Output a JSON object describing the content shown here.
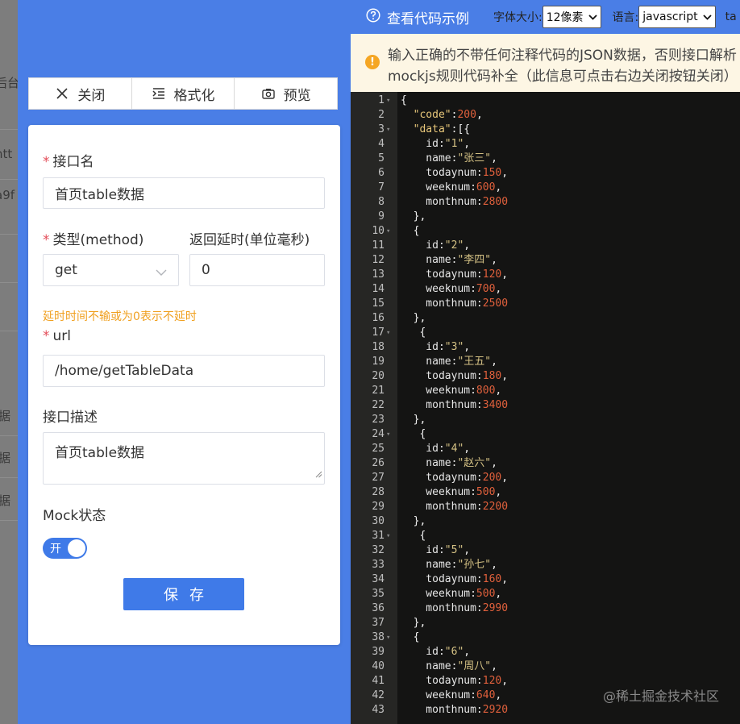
{
  "bg_page": {
    "fragments": [
      "后台",
      "htt",
      "a9f",
      "据",
      "据",
      "据"
    ]
  },
  "toolbar": {
    "close_label": "关闭",
    "format_label": "格式化",
    "preview_label": "预览"
  },
  "form": {
    "name_label": "接口名",
    "name_value": "首页table数据",
    "type_label": "类型(method)",
    "type_value": "get",
    "delay_label": "返回延时(单位毫秒)",
    "delay_value": "0",
    "delay_hint": "延时时间不输或为0表示不延时",
    "url_label": "url",
    "url_value": "/home/getTableData",
    "desc_label": "接口描述",
    "desc_value": "首页table数据",
    "mock_label": "Mock状态",
    "mock_toggle_text": "开",
    "mock_enabled": true,
    "save_label": "保存"
  },
  "editor_bar": {
    "code_example_label": "查看代码示例",
    "font_size_label": "字体大小:",
    "font_size_value": "12像素",
    "language_label": "语言:",
    "language_value": "javascript",
    "extra_label": "ta"
  },
  "warning": {
    "line1": "输入正确的不带任何注释代码的JSON数据，否则接口解析",
    "line2": "mockjs规则代码补全（此信息可点击右边关闭按钮关闭）"
  },
  "code_lines": [
    {
      "n": "1",
      "fold": true,
      "t": [
        [
          "{",
          "brace"
        ]
      ]
    },
    {
      "n": "2",
      "t": [
        [
          "  ",
          ""
        ],
        [
          "\"code\"",
          "qkey"
        ],
        [
          ":",
          "brace"
        ],
        [
          "200",
          "num"
        ],
        [
          ",",
          "brace"
        ]
      ]
    },
    {
      "n": "3",
      "fold": true,
      "t": [
        [
          "  ",
          ""
        ],
        [
          "\"data\"",
          "qkey"
        ],
        [
          ":[{",
          "brace"
        ]
      ]
    },
    {
      "n": "4",
      "t": [
        [
          "    id:",
          "key"
        ],
        [
          "\"1\"",
          "str"
        ],
        [
          ",",
          "brace"
        ]
      ]
    },
    {
      "n": "5",
      "t": [
        [
          "    name:",
          "key"
        ],
        [
          "\"张三\"",
          "str"
        ],
        [
          ",",
          "brace"
        ]
      ]
    },
    {
      "n": "6",
      "t": [
        [
          "    todaynum:",
          "key"
        ],
        [
          "150",
          "num"
        ],
        [
          ",",
          "brace"
        ]
      ]
    },
    {
      "n": "7",
      "t": [
        [
          "    weeknum:",
          "key"
        ],
        [
          "600",
          "num"
        ],
        [
          ",",
          "brace"
        ]
      ]
    },
    {
      "n": "8",
      "t": [
        [
          "    monthnum:",
          "key"
        ],
        [
          "2800",
          "num"
        ]
      ]
    },
    {
      "n": "9",
      "t": [
        [
          "  },",
          "brace"
        ]
      ]
    },
    {
      "n": "10",
      "fold": true,
      "t": [
        [
          "  {",
          "brace"
        ]
      ]
    },
    {
      "n": "11",
      "t": [
        [
          "    id:",
          "key"
        ],
        [
          "\"2\"",
          "str"
        ],
        [
          ",",
          "brace"
        ]
      ]
    },
    {
      "n": "12",
      "t": [
        [
          "    name:",
          "key"
        ],
        [
          "\"李四\"",
          "str"
        ],
        [
          ",",
          "brace"
        ]
      ]
    },
    {
      "n": "13",
      "t": [
        [
          "    todaynum:",
          "key"
        ],
        [
          "120",
          "num"
        ],
        [
          ",",
          "brace"
        ]
      ]
    },
    {
      "n": "14",
      "t": [
        [
          "    weeknum:",
          "key"
        ],
        [
          "700",
          "num"
        ],
        [
          ",",
          "brace"
        ]
      ]
    },
    {
      "n": "15",
      "t": [
        [
          "    monthnum:",
          "key"
        ],
        [
          "2500",
          "num"
        ]
      ]
    },
    {
      "n": "16",
      "t": [
        [
          "  },",
          "brace"
        ]
      ]
    },
    {
      "n": "17",
      "fold": true,
      "t": [
        [
          "   {",
          "brace"
        ]
      ]
    },
    {
      "n": "18",
      "t": [
        [
          "    id:",
          "key"
        ],
        [
          "\"3\"",
          "str"
        ],
        [
          ",",
          "brace"
        ]
      ]
    },
    {
      "n": "19",
      "t": [
        [
          "    name:",
          "key"
        ],
        [
          "\"王五\"",
          "str"
        ],
        [
          ",",
          "brace"
        ]
      ]
    },
    {
      "n": "20",
      "t": [
        [
          "    todaynum:",
          "key"
        ],
        [
          "180",
          "num"
        ],
        [
          ",",
          "brace"
        ]
      ]
    },
    {
      "n": "21",
      "t": [
        [
          "    weeknum:",
          "key"
        ],
        [
          "800",
          "num"
        ],
        [
          ",",
          "brace"
        ]
      ]
    },
    {
      "n": "22",
      "t": [
        [
          "    monthnum:",
          "key"
        ],
        [
          "3400",
          "num"
        ]
      ]
    },
    {
      "n": "23",
      "t": [
        [
          "  },",
          "brace"
        ]
      ]
    },
    {
      "n": "24",
      "fold": true,
      "t": [
        [
          "   {",
          "brace"
        ]
      ]
    },
    {
      "n": "25",
      "t": [
        [
          "    id:",
          "key"
        ],
        [
          "\"4\"",
          "str"
        ],
        [
          ",",
          "brace"
        ]
      ]
    },
    {
      "n": "26",
      "t": [
        [
          "    name:",
          "key"
        ],
        [
          "\"赵六\"",
          "str"
        ],
        [
          ",",
          "brace"
        ]
      ]
    },
    {
      "n": "27",
      "t": [
        [
          "    todaynum:",
          "key"
        ],
        [
          "200",
          "num"
        ],
        [
          ",",
          "brace"
        ]
      ]
    },
    {
      "n": "28",
      "t": [
        [
          "    weeknum:",
          "key"
        ],
        [
          "500",
          "num"
        ],
        [
          ",",
          "brace"
        ]
      ]
    },
    {
      "n": "29",
      "t": [
        [
          "    monthnum:",
          "key"
        ],
        [
          "2200",
          "num"
        ]
      ]
    },
    {
      "n": "30",
      "t": [
        [
          "  },",
          "brace"
        ]
      ]
    },
    {
      "n": "31",
      "fold": true,
      "t": [
        [
          "   {",
          "brace"
        ]
      ]
    },
    {
      "n": "32",
      "t": [
        [
          "    id:",
          "key"
        ],
        [
          "\"5\"",
          "str"
        ],
        [
          ",",
          "brace"
        ]
      ]
    },
    {
      "n": "33",
      "t": [
        [
          "    name:",
          "key"
        ],
        [
          "\"孙七\"",
          "str"
        ],
        [
          ",",
          "brace"
        ]
      ]
    },
    {
      "n": "34",
      "t": [
        [
          "    todaynum:",
          "key"
        ],
        [
          "160",
          "num"
        ],
        [
          ",",
          "brace"
        ]
      ]
    },
    {
      "n": "35",
      "t": [
        [
          "    weeknum:",
          "key"
        ],
        [
          "500",
          "num"
        ],
        [
          ",",
          "brace"
        ]
      ]
    },
    {
      "n": "36",
      "t": [
        [
          "    monthnum:",
          "key"
        ],
        [
          "2990",
          "num"
        ]
      ]
    },
    {
      "n": "37",
      "t": [
        [
          "  },",
          "brace"
        ]
      ]
    },
    {
      "n": "38",
      "fold": true,
      "t": [
        [
          "  {",
          "brace"
        ]
      ]
    },
    {
      "n": "39",
      "t": [
        [
          "    id:",
          "key"
        ],
        [
          "\"6\"",
          "str"
        ],
        [
          ",",
          "brace"
        ]
      ]
    },
    {
      "n": "40",
      "t": [
        [
          "    name:",
          "key"
        ],
        [
          "\"周八\"",
          "str"
        ],
        [
          ",",
          "brace"
        ]
      ]
    },
    {
      "n": "41",
      "t": [
        [
          "    todaynum:",
          "key"
        ],
        [
          "120",
          "num"
        ],
        [
          ",",
          "brace"
        ]
      ]
    },
    {
      "n": "42",
      "t": [
        [
          "    weeknum:",
          "key"
        ],
        [
          "640",
          "num"
        ],
        [
          ",",
          "brace"
        ]
      ]
    },
    {
      "n": "43",
      "t": [
        [
          "    monthnum:",
          "key"
        ],
        [
          "2920",
          "num"
        ]
      ]
    }
  ],
  "watermark": "@稀土掘金技术社区",
  "colors": {
    "accent_blue": "#4a7ee6",
    "primary_button": "#3f7ae8",
    "required_star": "#e34d59",
    "hint_orange": "#f0a020",
    "warning_bg": "#fdf6e4",
    "editor_bg": "#141413",
    "number_token": "#e0603c",
    "string_token": "#d4c184"
  }
}
